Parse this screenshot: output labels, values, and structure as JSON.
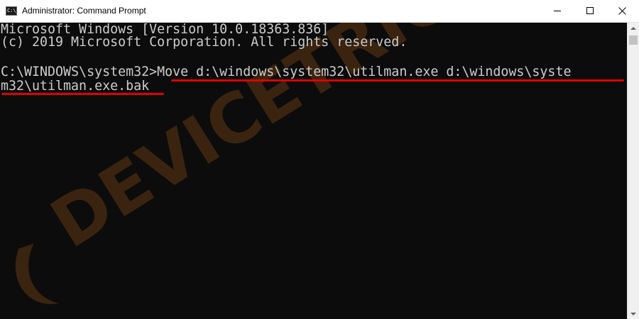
{
  "window": {
    "title": "Administrator: Command Prompt",
    "icon_label": "C:\\_"
  },
  "console": {
    "lines": [
      "Microsoft Windows [Version 10.0.18363.836]",
      "(c) 2019 Microsoft Corporation. All rights reserved.",
      "",
      "C:\\WINDOWS\\system32>Move d:\\windows\\system32\\utilman.exe d:\\windows\\syste",
      "m32\\utilman.exe.bak"
    ]
  },
  "watermark": {
    "text": "DEVICETRICKS",
    "color": "#3a2410"
  },
  "colors": {
    "console_bg": "#0c0c0c",
    "console_text": "#cccccc",
    "highlight": "#e00000"
  }
}
